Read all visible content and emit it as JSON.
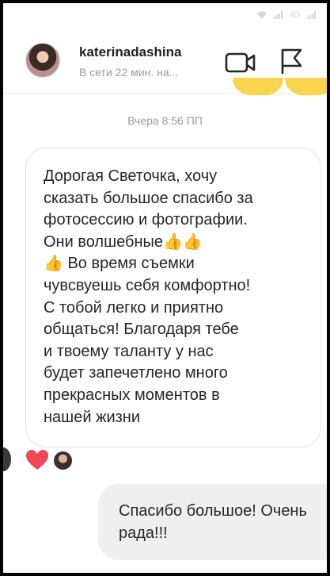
{
  "status_bar": {
    "network": "4G"
  },
  "header": {
    "username": "katerinadashina",
    "presence": "В сети 22 мин. на..."
  },
  "thread": {
    "timestamp": "Вчера 8:56 ПП",
    "incoming_message": "Дорогая Светочка, хочу\nсказать большое спасибо за\nфотосессию и фотографии.\nОни волшебные👍👍\n👍 Во время съемки\nчувсвуешь себя комфортно!\nС тобой легко и приятно\nобщаться! Благодаря тебе\nи твоему таланту у нас\nбудет запечетлено много\nпрекрасных моментов в\nнашей жизни",
    "reaction": "heart",
    "outgoing_message": "Спасибо большое! Очень\nрада!!!"
  },
  "colors": {
    "heart": "#ed4956",
    "incoming_border": "#e2e2e2",
    "outgoing_bg": "#efefef",
    "text": "#262626",
    "muted": "#9a9a9a",
    "accent_blob": "#f9d44d"
  },
  "icons": [
    "video-call-icon",
    "flag-icon",
    "heart-icon",
    "signal-icon",
    "wifi-icon"
  ]
}
